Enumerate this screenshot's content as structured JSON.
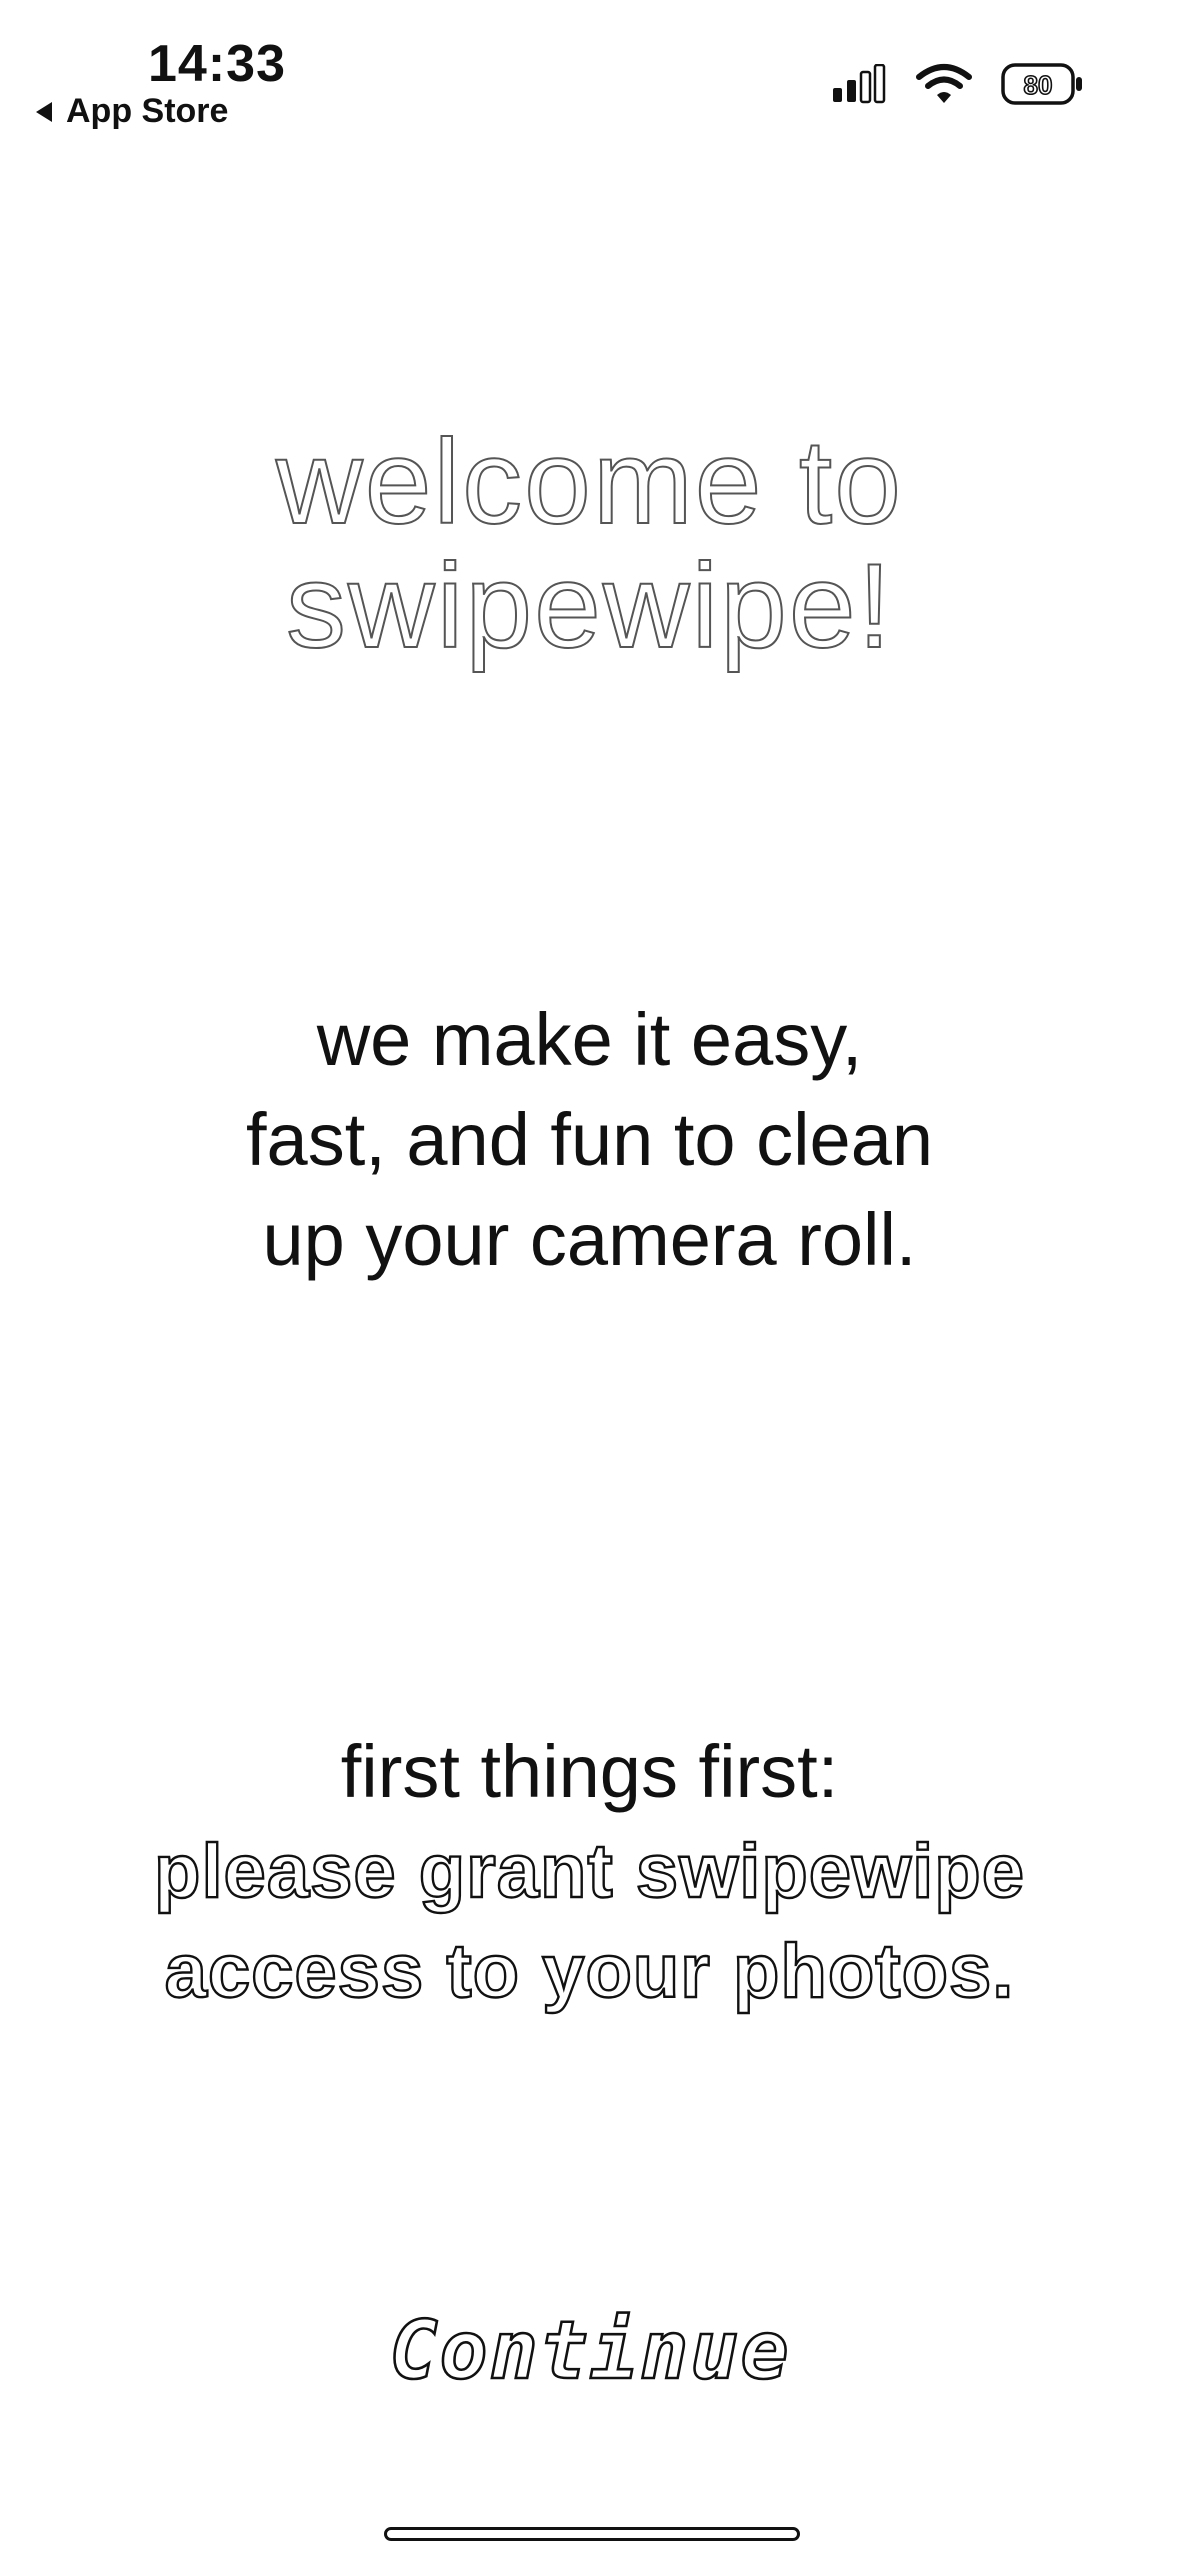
{
  "status_bar": {
    "time": "14:33",
    "back_label": "App Store",
    "battery_level": "80",
    "icons": [
      "signal-icon",
      "wifi-icon",
      "battery-icon"
    ]
  },
  "welcome": {
    "title_line1": "welcome to",
    "title_line2": "swipewipe!"
  },
  "tagline": {
    "line1": "we make it easy,",
    "line2": "fast, and fun to clean",
    "line3": "up your camera roll."
  },
  "permission": {
    "lead": "first things first:",
    "line1": "please grant swipewipe",
    "line2": "access to your photos."
  },
  "actions": {
    "continue_label": "Continue"
  },
  "colors": {
    "background": "#ffffff",
    "text": "#111111"
  }
}
